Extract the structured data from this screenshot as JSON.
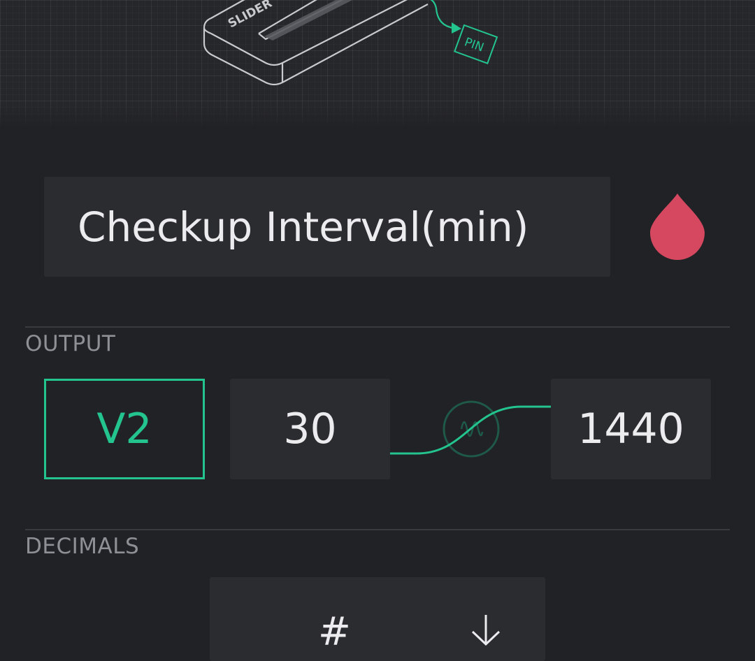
{
  "hero": {
    "widget_label": "SLIDER",
    "pin_label": "PIN"
  },
  "name_field": {
    "value": "Checkup Interval(min)"
  },
  "color": {
    "accent": "#23c48e",
    "drop": "#d5485f"
  },
  "output": {
    "label": "OUTPUT",
    "pin": "V2",
    "min": "30",
    "max": "1440"
  },
  "decimals": {
    "label": "DECIMALS",
    "value": "#"
  },
  "icons": {
    "color_picker": "drop-icon",
    "mapping": "sine-wave-icon",
    "dropdown": "arrow-down-icon"
  }
}
